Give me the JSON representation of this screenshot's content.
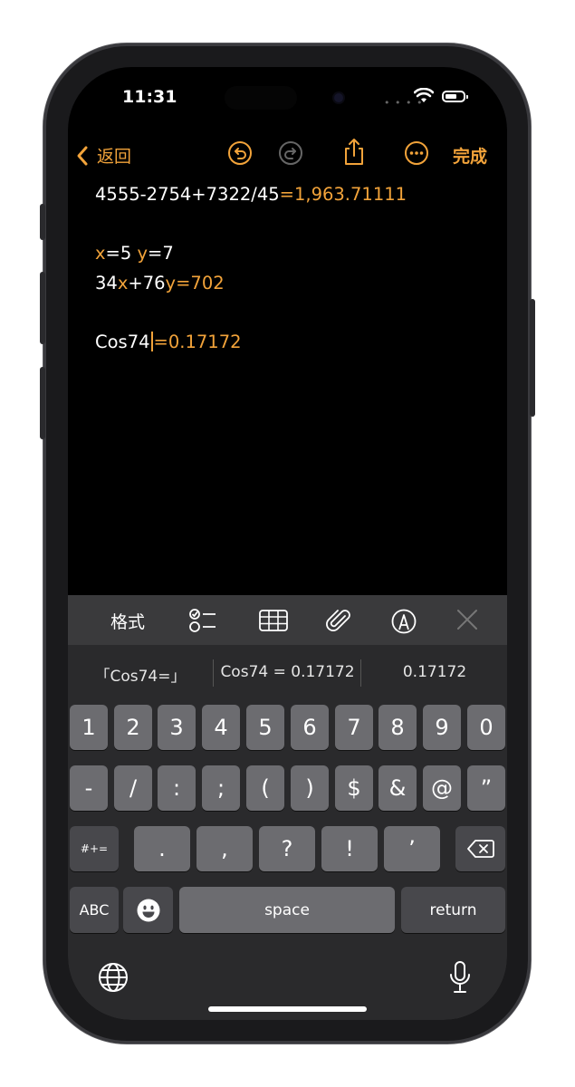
{
  "status": {
    "time": "11:31"
  },
  "nav": {
    "back_label": "返回",
    "done_label": "完成"
  },
  "note": {
    "line1": {
      "expr": "4555-2754+7322/45",
      "result": "1,963.71111"
    },
    "line2": {
      "x": "x",
      "x_val": "=5 ",
      "y": "y",
      "y_val": "=7"
    },
    "line3": {
      "a": "34",
      "x": "x",
      "b": "+76",
      "y": "y",
      "result": "702"
    },
    "line4": {
      "expr": "Cos74",
      "result": "0.17172"
    }
  },
  "toolbar": {
    "format_label": "格式"
  },
  "suggestions": [
    "「Cos74=」",
    "Cos74 = 0.17172",
    "0.17172"
  ],
  "keys": {
    "row1": [
      "1",
      "2",
      "3",
      "4",
      "5",
      "6",
      "7",
      "8",
      "9",
      "0"
    ],
    "row2": [
      "-",
      "/",
      ":",
      ";",
      "(",
      ")",
      "$",
      "&",
      "@",
      "”"
    ],
    "row3": [
      ".",
      ",",
      "?",
      "!",
      "’"
    ],
    "symbols": "#+=",
    "abc": "ABC",
    "space": "space",
    "return": "return"
  },
  "colors": {
    "accent": "#f2a33a",
    "key": "#6c6c70",
    "key_dark": "#48484c"
  }
}
